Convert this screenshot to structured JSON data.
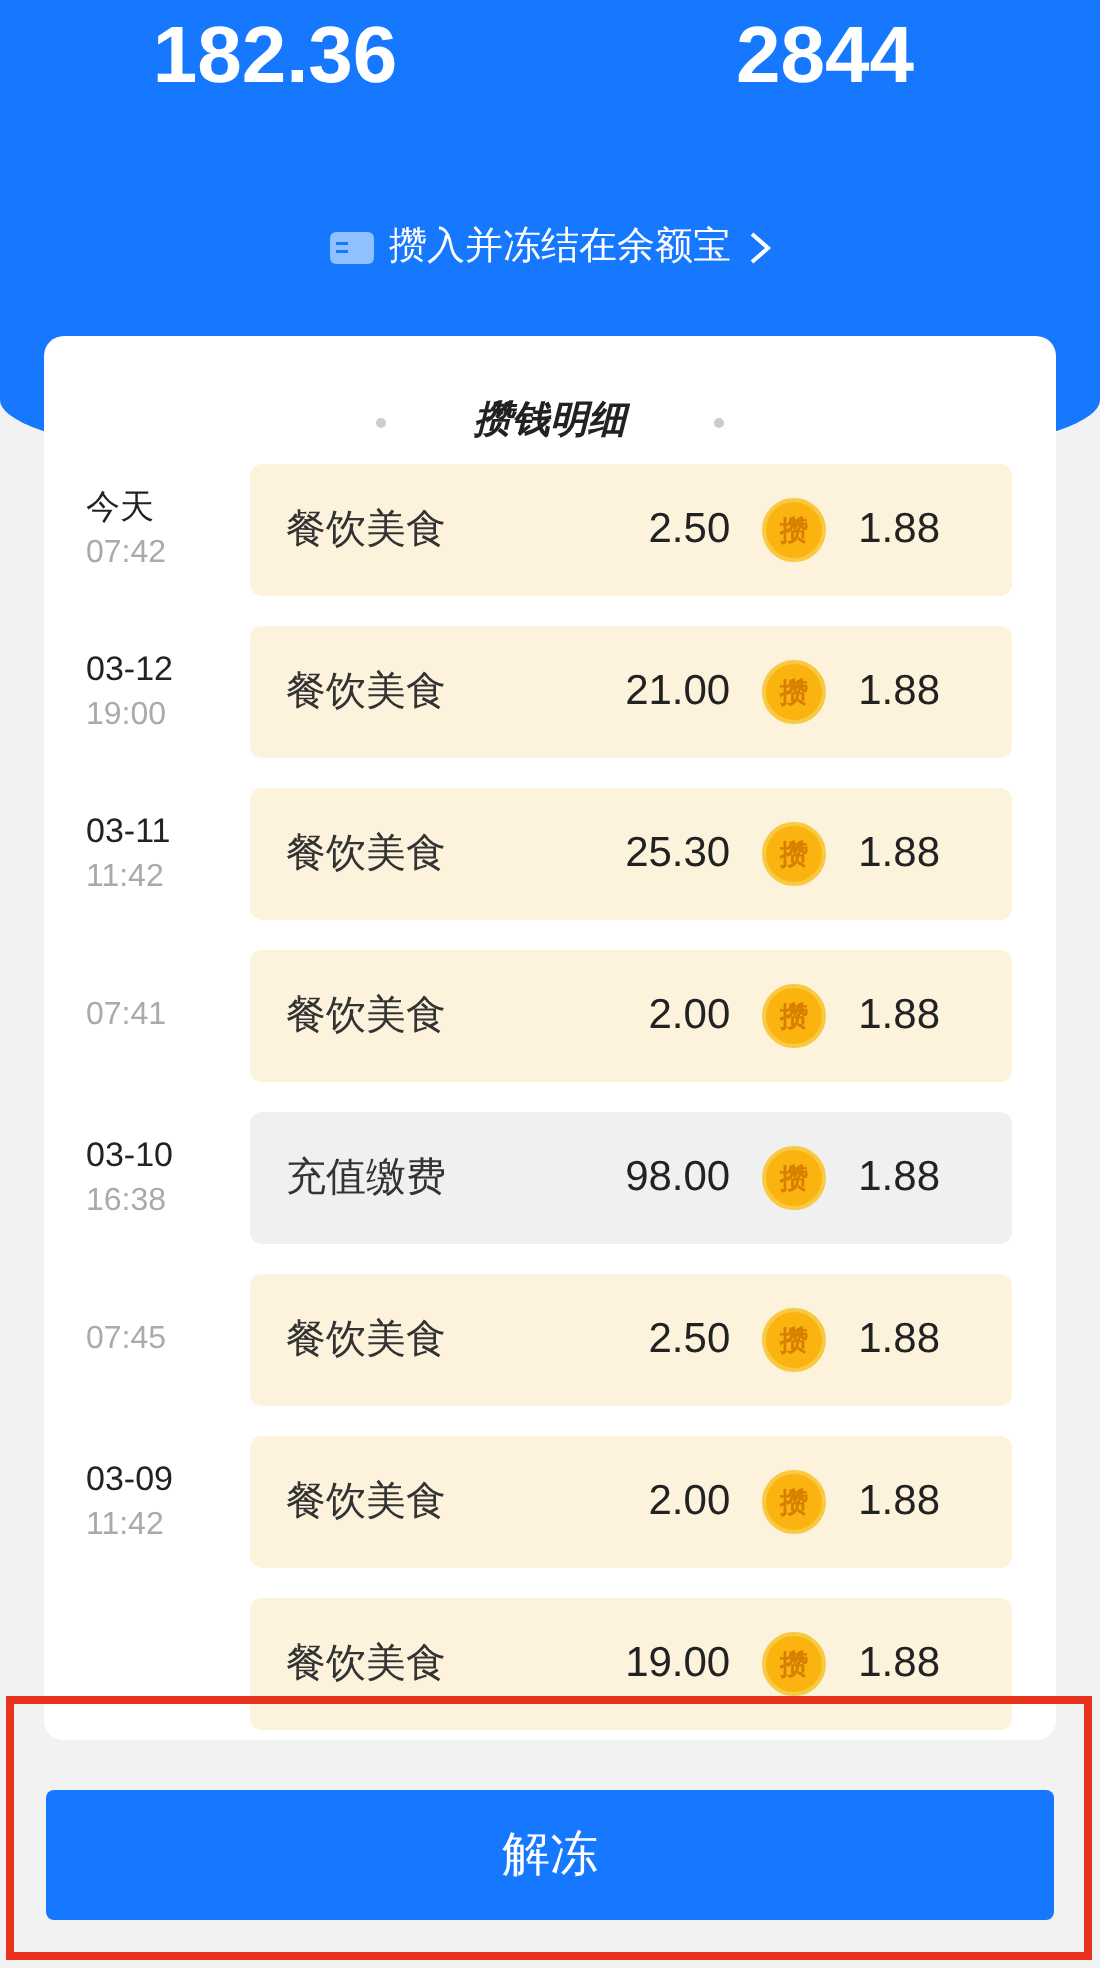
{
  "summary": {
    "values": [
      "182.36",
      "2844"
    ],
    "link": "攒入并冻结在余额宝"
  },
  "detail": {
    "title": "攒钱明细",
    "rows": [
      {
        "date": "今天",
        "time": "07:42",
        "category": "餐饮美食",
        "amount": "2.50",
        "badge": "攒",
        "saved": "1.88",
        "color": "#fdf3dc"
      },
      {
        "date": "03-12",
        "time": "19:00",
        "category": "餐饮美食",
        "amount": "21.00",
        "badge": "攒",
        "saved": "1.88",
        "color": "#fdf3dc"
      },
      {
        "date": "03-11",
        "time": "11:42",
        "category": "餐饮美食",
        "amount": "25.30",
        "badge": "攒",
        "saved": "1.88",
        "color": "#fdf3dc"
      },
      {
        "time": "07:41",
        "category": "餐饮美食",
        "amount": "2.00",
        "badge": "攒",
        "saved": "1.88",
        "color": "#fdf3dc"
      },
      {
        "date": "03-10",
        "time": "16:38",
        "category": "充值缴费",
        "amount": "98.00",
        "badge": "攒",
        "saved": "1.88",
        "color": "#f0f0f0"
      },
      {
        "time": "07:45",
        "category": "餐饮美食",
        "amount": "2.50",
        "badge": "攒",
        "saved": "1.88",
        "color": "#fdf3dc"
      },
      {
        "date": "03-09",
        "time": "11:42",
        "category": "餐饮美食",
        "amount": "2.00",
        "badge": "攒",
        "saved": "1.88",
        "color": "#fdf3dc"
      },
      {
        "category": "餐饮美食",
        "amount": "19.00",
        "badge": "攒",
        "saved": "1.88",
        "color": "#fdf3dc"
      }
    ]
  },
  "button": "解冻"
}
